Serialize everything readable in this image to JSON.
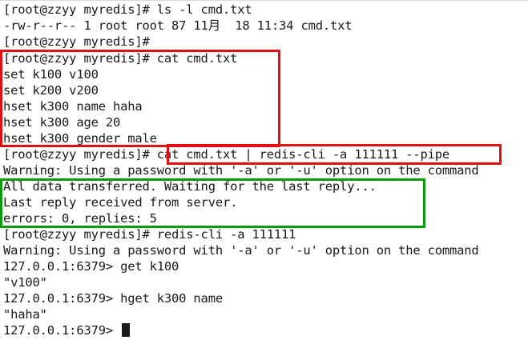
{
  "terminal": {
    "lines": [
      "[root@zzyy myredis]# ls -l cmd.txt",
      "-rw-r--r-- 1 root root 87 11月  18 11:34 cmd.txt",
      "[root@zzyy myredis]#",
      "[root@zzyy myredis]# cat cmd.txt",
      "set k100 v100",
      "set k200 v200",
      "hset k300 name haha",
      "hset k300 age 20",
      "hset k300 gender male",
      "[root@zzyy myredis]# cat cmd.txt | redis-cli -a 111111 --pipe",
      "Warning: Using a password with '-a' or '-u' option on the command",
      "All data transferred. Waiting for the last reply...",
      "Last reply received from server.",
      "errors: 0, replies: 5",
      "[root@zzyy myredis]# redis-cli -a 111111",
      "Warning: Using a password with '-a' or '-u' option on the command",
      "127.0.0.1:6379> get k100",
      "\"v100\"",
      "127.0.0.1:6379> hget k300 name",
      "\"haha\"",
      "127.0.0.1:6379> "
    ]
  },
  "colors": {
    "background": "#ffffff",
    "text": "#1a1a1a",
    "highlight_red": "#e01010",
    "highlight_green": "#0a9a0a"
  }
}
